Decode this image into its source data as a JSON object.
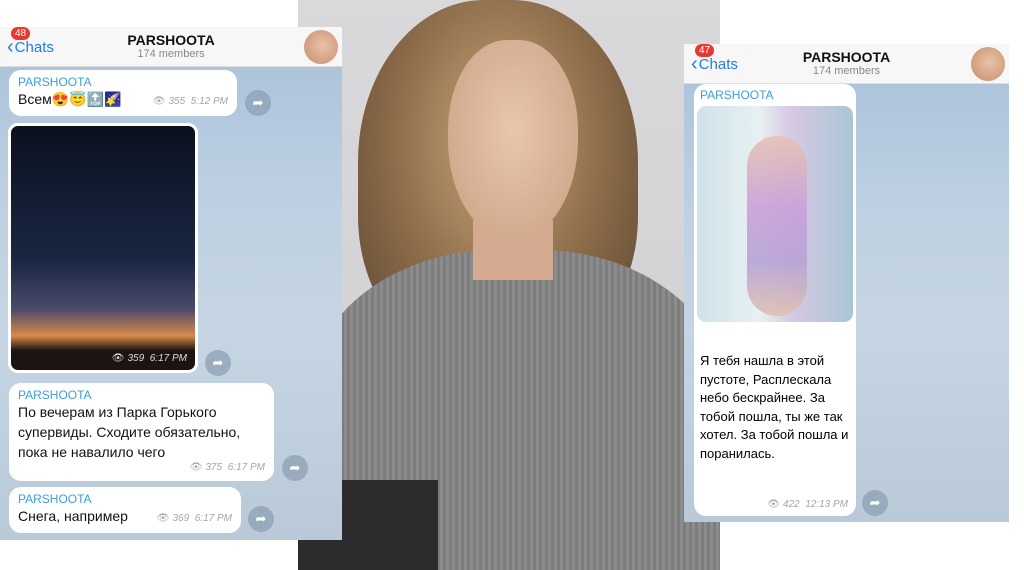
{
  "left_chat": {
    "header": {
      "back_label": "Chats",
      "unread_badge": "48",
      "title": "PARSHOOTA",
      "members": "174 members"
    },
    "messages": [
      {
        "sender": "PARSHOOTA",
        "text": "Всем😍😇🔝🌠",
        "views": "355",
        "time": "5:12 PM"
      },
      {
        "type": "photo",
        "views": "359",
        "time": "6:17 PM"
      },
      {
        "sender": "PARSHOOTA",
        "text": "По вечерам из Парка Горького супервиды. Сходите обязательно, пока не навалило чего",
        "views": "375",
        "time": "6:17 PM"
      },
      {
        "sender": "PARSHOOTA",
        "text": "Снега, например",
        "views": "369",
        "time": "6:17 PM"
      }
    ]
  },
  "right_chat": {
    "header": {
      "back_label": "Chats",
      "unread_badge": "47",
      "title": "PARSHOOTA",
      "members": "174 members"
    },
    "messages": [
      {
        "sender": "PARSHOOTA",
        "type": "photo",
        "text": "Я тебя нашла в этой пустоте, Расплескала небо бескрайнее. За тобой пошла, ты же так хотел. За тобой пошла и поранилась.",
        "views": "422",
        "time": "12:13 PM"
      }
    ]
  },
  "icons": {
    "back": "chevron-left-icon",
    "views": "eye-icon",
    "forward": "share-arrow-icon"
  },
  "colors": {
    "accent": "#1f7ee0",
    "sender": "#3b9fd8",
    "badge": "#e8382f"
  }
}
